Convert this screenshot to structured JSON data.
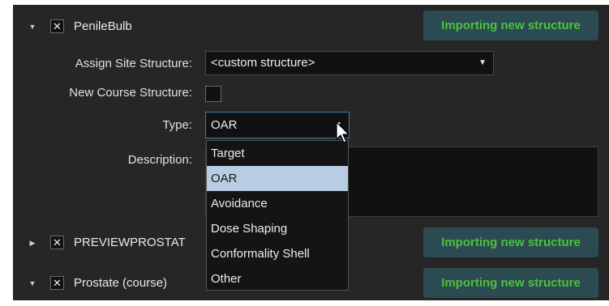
{
  "structures": [
    {
      "name": "PenileBulb",
      "toggle_icon": "triangle-down-icon",
      "checkbox_mark": "✕",
      "status": "Importing new structure",
      "expanded": true
    },
    {
      "name": "PREVIEWPROSTAT",
      "toggle_icon": "triangle-right-icon",
      "checkbox_mark": "✕",
      "status": "Importing new structure",
      "expanded": false
    },
    {
      "name": "Prostate (course)",
      "toggle_icon": "triangle-down-icon",
      "checkbox_mark": "✕",
      "status": "Importing new structure",
      "expanded": true
    }
  ],
  "form": {
    "assign_site_label": "Assign Site Structure:",
    "assign_site_value": "<custom structure>",
    "new_course_label": "New Course Structure:",
    "type_label": "Type:",
    "type_value": "OAR",
    "description_label": "Description:"
  },
  "type_options": [
    "Target",
    "OAR",
    "Avoidance",
    "Dose Shaping",
    "Conformality Shell",
    "Other"
  ],
  "selected_option": "OAR",
  "colors": {
    "panel_bg": "#262626",
    "status_text": "#4cc23b",
    "status_bg": "#2c4a52",
    "selected_option_bg": "#b8cde3",
    "focus_border": "#3d7fa6"
  }
}
